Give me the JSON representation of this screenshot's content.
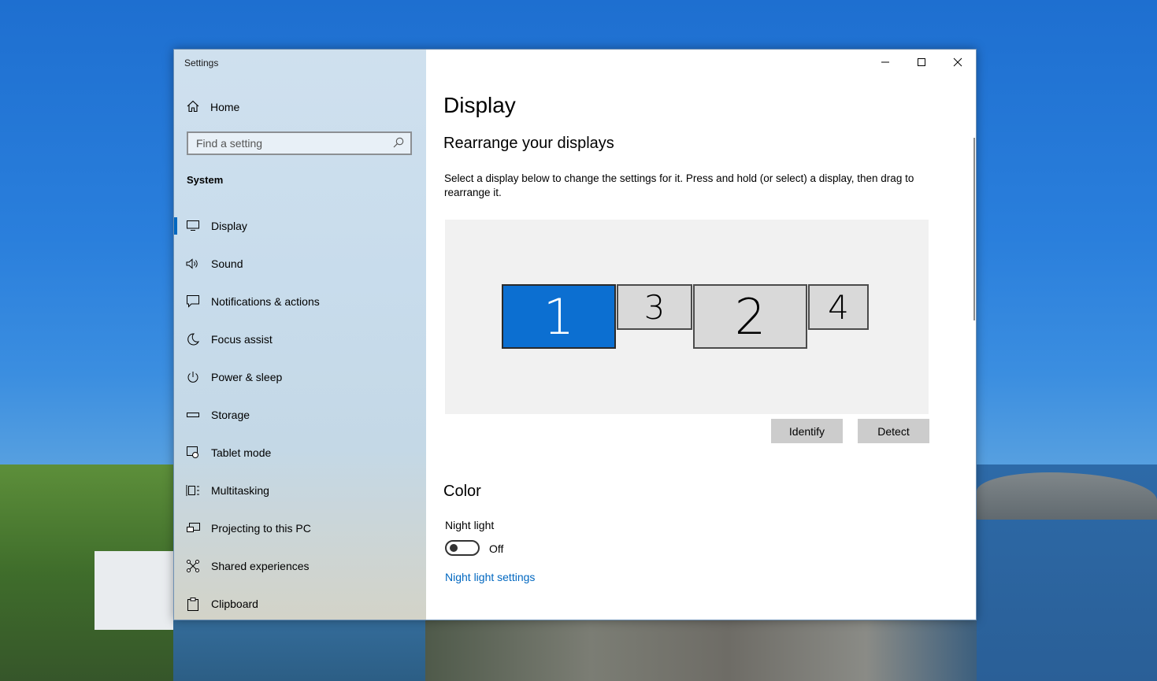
{
  "window": {
    "title": "Settings",
    "controls": [
      "minimize",
      "maximize",
      "close"
    ]
  },
  "sidebar": {
    "home_label": "Home",
    "search_placeholder": "Find a setting",
    "section": "System",
    "items": [
      {
        "label": "Display",
        "icon": "monitor-icon",
        "active": true
      },
      {
        "label": "Sound",
        "icon": "speaker-icon"
      },
      {
        "label": "Notifications & actions",
        "icon": "notification-icon"
      },
      {
        "label": "Focus assist",
        "icon": "moon-icon"
      },
      {
        "label": "Power & sleep",
        "icon": "power-icon"
      },
      {
        "label": "Storage",
        "icon": "storage-icon"
      },
      {
        "label": "Tablet mode",
        "icon": "tablet-mode-icon"
      },
      {
        "label": "Multitasking",
        "icon": "multitasking-icon"
      },
      {
        "label": "Projecting to this PC",
        "icon": "projecting-icon"
      },
      {
        "label": "Shared experiences",
        "icon": "shared-experiences-icon"
      },
      {
        "label": "Clipboard",
        "icon": "clipboard-icon"
      }
    ]
  },
  "main": {
    "title": "Display",
    "rearrange_title": "Rearrange your displays",
    "description": "Select a display below to change the settings for it. Press and hold (or select) a display, then drag to rearrange it.",
    "monitors": [
      {
        "label": "1",
        "selected": true
      },
      {
        "label": "3",
        "selected": false
      },
      {
        "label": "2",
        "selected": false
      },
      {
        "label": "4",
        "selected": false
      }
    ],
    "identify_label": "Identify",
    "detect_label": "Detect",
    "color_title": "Color",
    "night_light_label": "Night light",
    "night_light_state": "Off",
    "night_light_link": "Night light settings"
  },
  "colors": {
    "accent": "#0067c0",
    "selected_monitor": "#0c6fd1",
    "monitor_fill": "#d9d9d9",
    "arrange_bg": "#f1f1f1"
  }
}
